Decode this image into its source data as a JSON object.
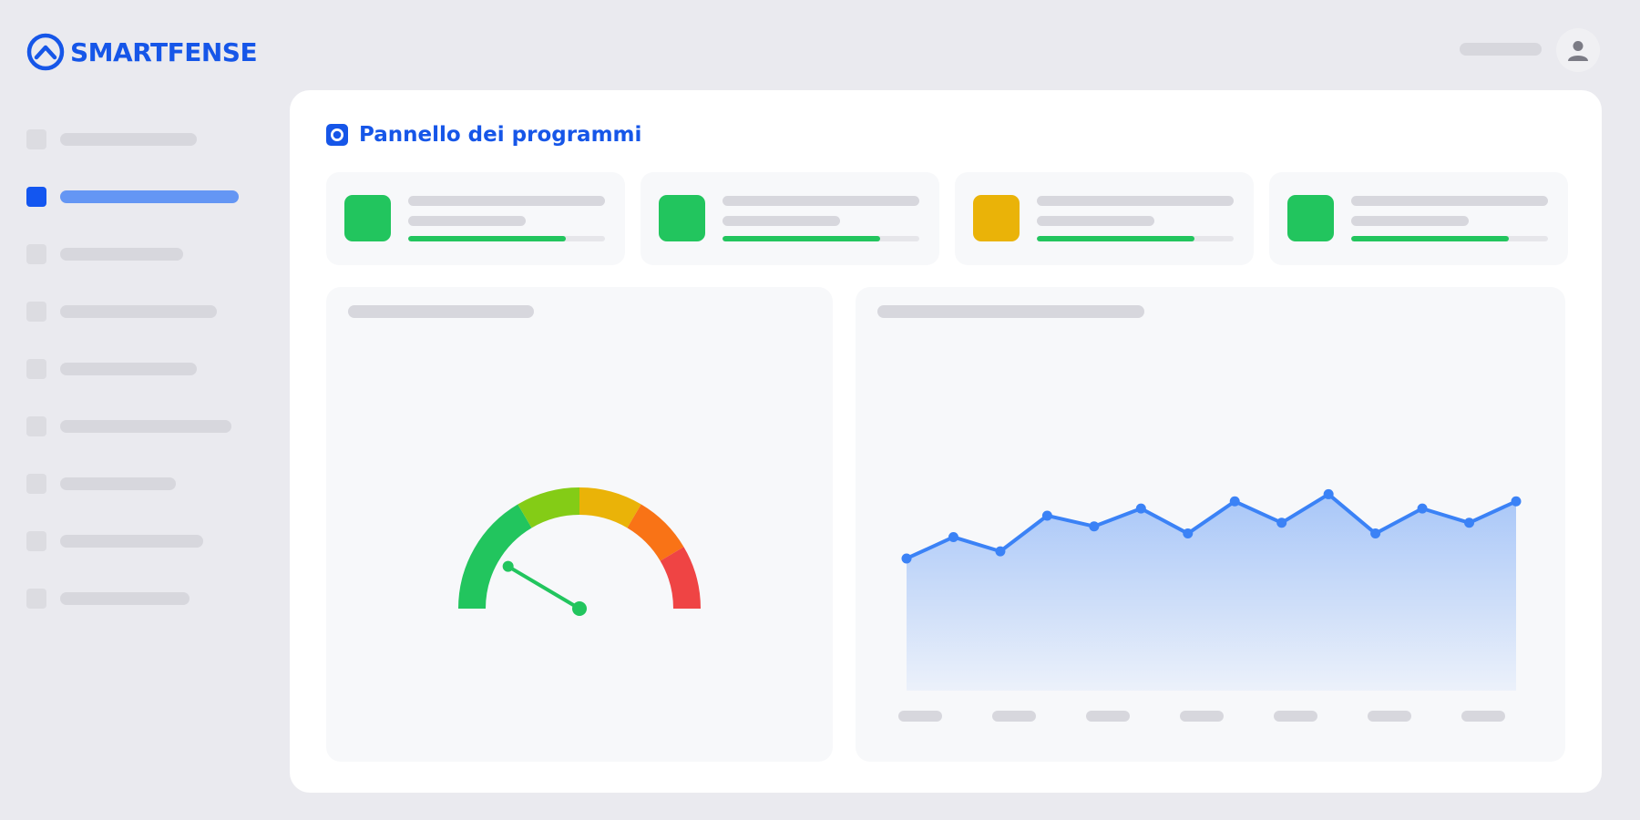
{
  "brand": {
    "name": "SMARTFENSE",
    "color": "#1656E8",
    "logo_icon": "shield-chevron-icon"
  },
  "header": {
    "user_icon": "user-icon"
  },
  "sidebar": {
    "active_index": 1,
    "active_color": "#1356F0",
    "items": [
      {
        "state": "default"
      },
      {
        "state": "active"
      },
      {
        "state": "default"
      },
      {
        "state": "default"
      },
      {
        "state": "default"
      },
      {
        "state": "default"
      },
      {
        "state": "default"
      },
      {
        "state": "default"
      },
      {
        "state": "default"
      }
    ]
  },
  "main": {
    "title": "Pannello dei programmi",
    "title_icon": "target-square-icon",
    "stats": [
      {
        "status_color": "#22C55E",
        "progress": 0.8
      },
      {
        "status_color": "#22C55E",
        "progress": 0.8
      },
      {
        "status_color": "#EAB308",
        "progress": 0.8
      },
      {
        "status_color": "#22C55E",
        "progress": 0.8
      }
    ]
  },
  "gauge": {
    "segments": [
      {
        "color": "#22C55E",
        "from": 0.0,
        "to": 0.33
      },
      {
        "color": "#84CC16",
        "from": 0.33,
        "to": 0.5
      },
      {
        "color": "#EAB308",
        "from": 0.5,
        "to": 0.67
      },
      {
        "color": "#F97316",
        "from": 0.67,
        "to": 0.83
      },
      {
        "color": "#EF4444",
        "from": 0.83,
        "to": 1.0
      }
    ],
    "value": 0.17,
    "needle_color": "#22C55E"
  },
  "chart_data": {
    "type": "area",
    "color": "#3B82F6",
    "grid": false,
    "values": [
      2.0,
      2.6,
      2.2,
      3.2,
      2.9,
      3.4,
      2.7,
      3.6,
      3.0,
      3.8,
      2.7,
      3.4,
      3.0,
      3.6
    ],
    "ylim": [
      -1.7,
      4.5
    ],
    "x_tick_count": 7
  }
}
